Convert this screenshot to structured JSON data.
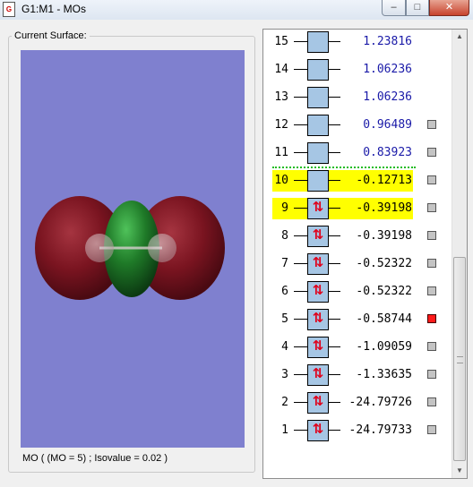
{
  "window": {
    "title": "G1:M1 - MOs",
    "icon": "gaussview-doc-icon",
    "controls": {
      "minimize": "–",
      "maximize": "□",
      "close": "✕"
    }
  },
  "surface_panel": {
    "label": "Current Surface:",
    "status": "MO ( (MO = 5) ; Isovalue = 0.02 )",
    "colors": {
      "background": "#7f80cf",
      "positive_lobe": "#7a1420",
      "negative_lobe": "#1f7a28"
    }
  },
  "mo_list": {
    "rows": [
      {
        "num": "15",
        "energy": "1.23816",
        "occupancy": "",
        "color": "#1a1aa8",
        "highlight": false,
        "checkbox": "none"
      },
      {
        "num": "14",
        "energy": "1.06236",
        "occupancy": "",
        "color": "#1a1aa8",
        "highlight": false,
        "checkbox": "none"
      },
      {
        "num": "13",
        "energy": "1.06236",
        "occupancy": "",
        "color": "#1a1aa8",
        "highlight": false,
        "checkbox": "none"
      },
      {
        "num": "12",
        "energy": "0.96489",
        "occupancy": "",
        "color": "#1a1aa8",
        "highlight": false,
        "checkbox": "off"
      },
      {
        "num": "11",
        "energy": "0.83923",
        "occupancy": "",
        "color": "#1a1aa8",
        "highlight": false,
        "checkbox": "off"
      },
      {
        "num": "10",
        "energy": "-0.12713",
        "occupancy": "",
        "color": "#000000",
        "highlight": true,
        "checkbox": "off"
      },
      {
        "num": "9",
        "energy": "-0.39198",
        "occupancy": "⇅",
        "color": "#000000",
        "highlight": true,
        "checkbox": "off"
      },
      {
        "num": "8",
        "energy": "-0.39198",
        "occupancy": "⇅",
        "color": "#000000",
        "highlight": false,
        "checkbox": "off"
      },
      {
        "num": "7",
        "energy": "-0.52322",
        "occupancy": "⇅",
        "color": "#000000",
        "highlight": false,
        "checkbox": "off"
      },
      {
        "num": "6",
        "energy": "-0.52322",
        "occupancy": "⇅",
        "color": "#000000",
        "highlight": false,
        "checkbox": "off"
      },
      {
        "num": "5",
        "energy": "-0.58744",
        "occupancy": "⇅",
        "color": "#000000",
        "highlight": false,
        "checkbox": "on"
      },
      {
        "num": "4",
        "energy": "-1.09059",
        "occupancy": "⇅",
        "color": "#000000",
        "highlight": false,
        "checkbox": "off"
      },
      {
        "num": "3",
        "energy": "-1.33635",
        "occupancy": "⇅",
        "color": "#000000",
        "highlight": false,
        "checkbox": "off"
      },
      {
        "num": "2",
        "energy": "-24.79726",
        "occupancy": "⇅",
        "color": "#000000",
        "highlight": false,
        "checkbox": "off"
      },
      {
        "num": "1",
        "energy": "-24.79733",
        "occupancy": "⇅",
        "color": "#000000",
        "highlight": false,
        "checkbox": "off"
      }
    ]
  }
}
